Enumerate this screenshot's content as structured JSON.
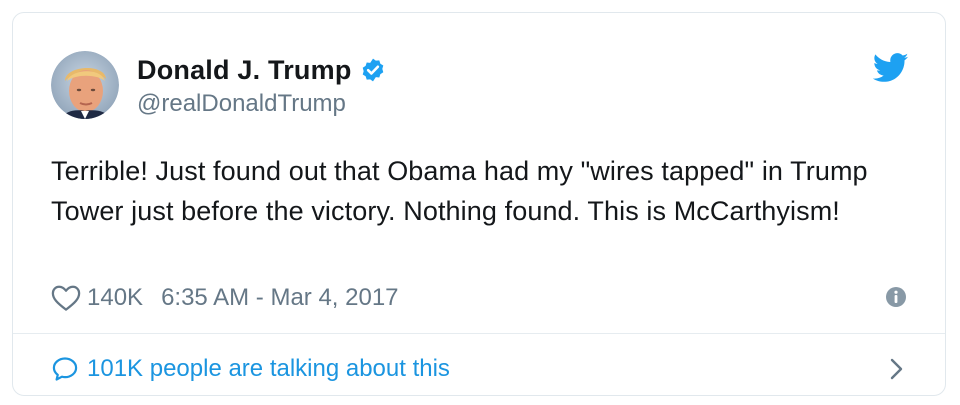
{
  "author": {
    "name": "Donald J. Trump",
    "handle": "@realDonaldTrump",
    "verified_icon": "verified-badge-icon"
  },
  "tweet": {
    "text": "Terrible! Just found out that Obama had my \"wires tapped\" in Trump Tower just before the victory. Nothing found. This is McCarthyism!",
    "likes": "140K",
    "timestamp": "6:35 AM - Mar 4, 2017"
  },
  "footer": {
    "talking_text": "101K people are talking about this"
  },
  "icons": {
    "brand": "twitter-bird-icon",
    "like": "heart-icon",
    "info": "info-icon",
    "conversation": "speech-bubble-icon",
    "navigate": "chevron-right-icon"
  },
  "colors": {
    "accent": "#1da1f2",
    "link": "#1b95e0",
    "text": "#14171a",
    "muted": "#657786",
    "border": "#e1e8ed"
  }
}
